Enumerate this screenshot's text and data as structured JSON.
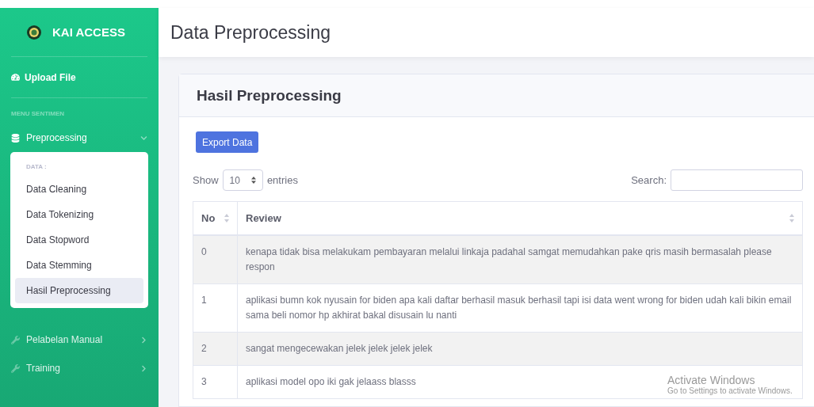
{
  "sidebar": {
    "brand": "KAI ACCESS",
    "top_item": {
      "label": "Upload File"
    },
    "section_heading": "MENU SENTIMEN",
    "items": [
      {
        "label": "Preprocessing",
        "expanded": true,
        "submenu": {
          "heading": "DATA :",
          "items": [
            {
              "label": "Data Cleaning",
              "selected": false
            },
            {
              "label": "Data Tokenizing",
              "selected": false
            },
            {
              "label": "Data Stopword",
              "selected": false
            },
            {
              "label": "Data Stemming",
              "selected": false
            },
            {
              "label": "Hasil Preprocessing",
              "selected": true
            }
          ]
        }
      },
      {
        "label": "Pelabelan Manual",
        "expanded": false
      },
      {
        "label": "Training",
        "expanded": false
      }
    ]
  },
  "page_title": "Data Preprocessing",
  "card": {
    "title": "Hasil Preprocessing",
    "export_button": "Export Data",
    "length": {
      "prefix": "Show",
      "value": "10",
      "suffix": "entries"
    },
    "search": {
      "label": "Search:"
    },
    "table": {
      "columns": [
        "No",
        "Review"
      ],
      "rows": [
        {
          "no": "0",
          "review": "kenapa tidak bisa melakukam pembayaran melalui linkaja padahal samgat memudahkan pake qris masih bermasalah please respon"
        },
        {
          "no": "1",
          "review": "aplikasi bumn kok nyusain for biden apa kali daftar berhasil masuk berhasil tapi isi data went wrong for biden udah kali bikin email sama beli nomor hp akhirat bakal disusain lu nanti"
        },
        {
          "no": "2",
          "review": "sangat mengecewakan jelek jelek jelek jelek"
        },
        {
          "no": "3",
          "review": "aplikasi model opo iki gak jelaass blasss"
        }
      ]
    }
  },
  "os_notice": {
    "title": "Activate Windows",
    "text": "Go to Settings to activate Windows."
  }
}
